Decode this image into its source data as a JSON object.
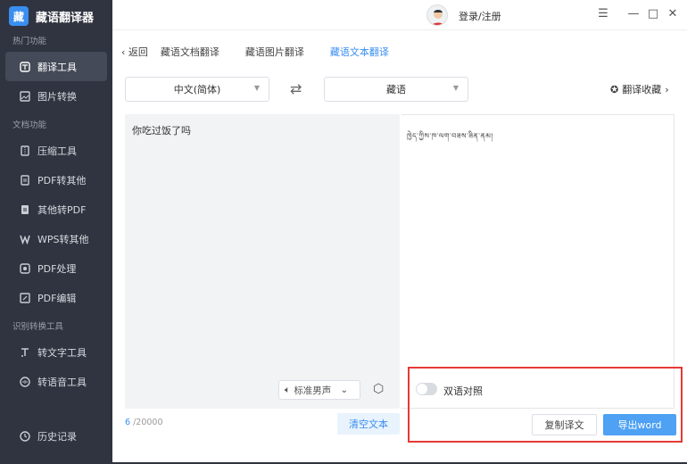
{
  "app": {
    "logo_text": "藏",
    "title": "藏语翻译器"
  },
  "sidebar": {
    "sections": [
      {
        "title": "热门功能",
        "items": [
          {
            "label": "翻译工具",
            "icon": "translate-icon",
            "active": true
          },
          {
            "label": "图片转换",
            "icon": "image-icon"
          }
        ]
      },
      {
        "title": "文档功能",
        "items": [
          {
            "label": "压缩工具",
            "icon": "compress-icon"
          },
          {
            "label": "PDF转其他",
            "icon": "pdf-icon"
          },
          {
            "label": "其他转PDF",
            "icon": "to-pdf-icon"
          },
          {
            "label": "WPS转其他",
            "icon": "wps-icon"
          },
          {
            "label": "PDF处理",
            "icon": "pdf-process-icon"
          },
          {
            "label": "PDF编辑",
            "icon": "pdf-edit-icon"
          }
        ]
      },
      {
        "title": "识别转换工具",
        "items": [
          {
            "label": "转文字工具",
            "icon": "text-icon"
          },
          {
            "label": "转语音工具",
            "icon": "voice-icon"
          }
        ]
      }
    ],
    "history": "历史记录"
  },
  "titlebar": {
    "login": "登录/注册"
  },
  "nav": {
    "back": "返回",
    "tabs": [
      {
        "label": "藏语文档翻译"
      },
      {
        "label": "藏语图片翻译"
      },
      {
        "label": "藏语文本翻译",
        "active": true
      }
    ]
  },
  "lang": {
    "source": "中文(简体)",
    "target": "藏语",
    "favorites": "翻译收藏"
  },
  "editor": {
    "source_text": "你吃过饭了吗",
    "target_text": "ཁྱེད་ཀྱིས་ཁ་ལག་བཟས་ཟིན་ནམ།",
    "voice": "标准男声",
    "count_current": "6",
    "count_max": "/20000",
    "clear": "清空文本"
  },
  "actions": {
    "bilingual": "双语对照",
    "copy": "复制译文",
    "export": "导出word"
  },
  "colors": {
    "accent": "#3a8ef0",
    "sidebar_bg": "#2f3440",
    "highlight": "#e53935"
  }
}
